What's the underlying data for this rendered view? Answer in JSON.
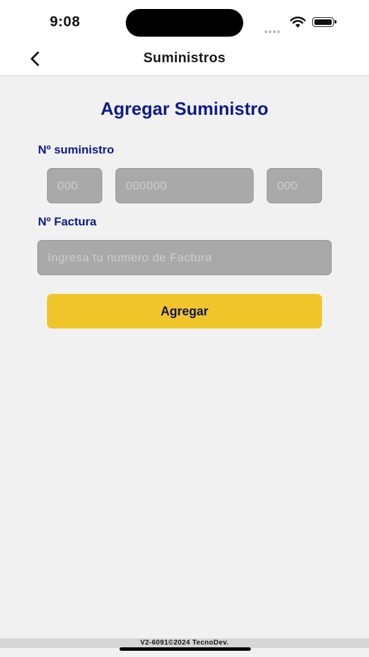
{
  "status_bar": {
    "time": "9:08"
  },
  "navbar": {
    "title": "Suministros"
  },
  "form": {
    "title": "Agregar Suministro",
    "suministro_label": "Nº suministro",
    "suministro_part1_placeholder": "000",
    "suministro_part2_placeholder": "000000",
    "suministro_part3_placeholder": "000",
    "factura_label": "Nº Factura",
    "factura_placeholder": "Ingresa tu numero de Factura",
    "submit_label": "Agregar"
  },
  "footer": {
    "text": "V2-6091©2024 TecnoDev."
  },
  "colors": {
    "primary_text": "#0d1a8c",
    "button_bg": "#f0c52a",
    "input_bg": "#a9a9a9",
    "page_bg": "#f1f1f1"
  }
}
